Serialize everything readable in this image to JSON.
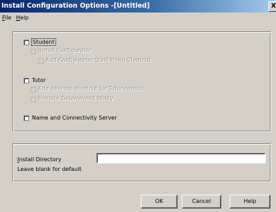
{
  "window": {
    "title": "Install Configuration Options -[Untitled]",
    "close_glyph": "X"
  },
  "menu": [
    {
      "label": "File",
      "mnemonic": "F",
      "rest": "ile"
    },
    {
      "label": "Help",
      "mnemonic": "H",
      "rest": "elp"
    }
  ],
  "options": {
    "student": {
      "label": "Student",
      "checked": false
    },
    "install_configurator": {
      "label": "Install Configurator",
      "checked": false,
      "enabled": false
    },
    "add_start_menu_shortcut": {
      "label": "Add Configurator Start Menu Shortcut",
      "checked": false,
      "enabled": false
    },
    "tutor": {
      "label": "Tutor",
      "checked": false
    },
    "add_desktop_shortcut": {
      "label": "Add desktop shortcut for Tutor control",
      "checked": false,
      "enabled": false
    },
    "remote_deployment": {
      "label": "Remote Deployment Utility",
      "checked": false,
      "enabled": false
    },
    "name_server": {
      "label": "Name and Connectivity Server",
      "checked": false
    }
  },
  "install": {
    "label": "Install Directory",
    "mnemonic": "I",
    "label_rest": "nstall Directory",
    "hint": "Leave blank for default",
    "value": ""
  },
  "buttons": {
    "ok": "OK",
    "cancel": "Cancel",
    "help": "Help"
  }
}
